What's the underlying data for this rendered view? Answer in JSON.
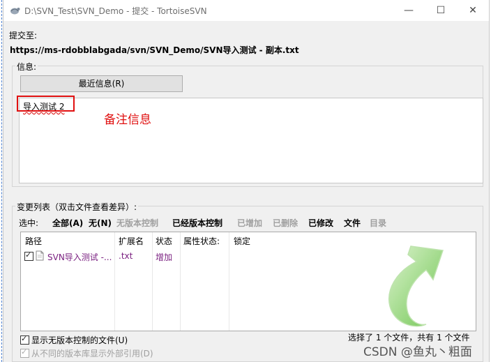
{
  "window": {
    "title": "D:\\SVN_Test\\SVN_Demo - 提交 - TortoiseSVN",
    "minimize_glyph": "—",
    "maximize_glyph": "☐",
    "close_glyph": "✕"
  },
  "commit_to": {
    "label": "提交至:",
    "url": "https://ms-rdobblabgada/svn/SVN_Demo/SVN导入测试 - 副本.txt"
  },
  "message": {
    "group_label": "信息:",
    "recent_button": "最近信息(R)",
    "text": "导入测试  2",
    "annotation": "备注信息"
  },
  "changes": {
    "group_label": "变更列表（双击文件查看差异）:",
    "select_label": "选中:",
    "filters": [
      {
        "label": "全部(A)",
        "enabled": true
      },
      {
        "label": "无(N)",
        "enabled": true
      },
      {
        "label": "无版本控制",
        "enabled": false
      },
      {
        "label": "已经版本控制",
        "enabled": true
      },
      {
        "label": "已增加",
        "enabled": false
      },
      {
        "label": "已删除",
        "enabled": false
      },
      {
        "label": "已修改",
        "enabled": true
      },
      {
        "label": "文件",
        "enabled": true
      },
      {
        "label": "目录",
        "enabled": false
      }
    ],
    "columns": [
      "路径",
      "扩展名",
      "状态",
      "属性状态:",
      "锁定"
    ],
    "rows": [
      {
        "path": "SVN导入测试 -...",
        "ext": ".txt",
        "status": "增加",
        "checked": true
      }
    ],
    "summary": "选择了 1 个文件，共有 1 个文件"
  },
  "options": {
    "show_unversioned": "显示无版本控制的文件(U)",
    "show_externals": "从不同的版本库显示外部引用(D)"
  },
  "watermark": "CSDN @鱼丸丶粗面",
  "colors": {
    "annotation_red": "#e01010",
    "added_purple": "#7a2080",
    "tortoise_green": "#6cc24a"
  }
}
